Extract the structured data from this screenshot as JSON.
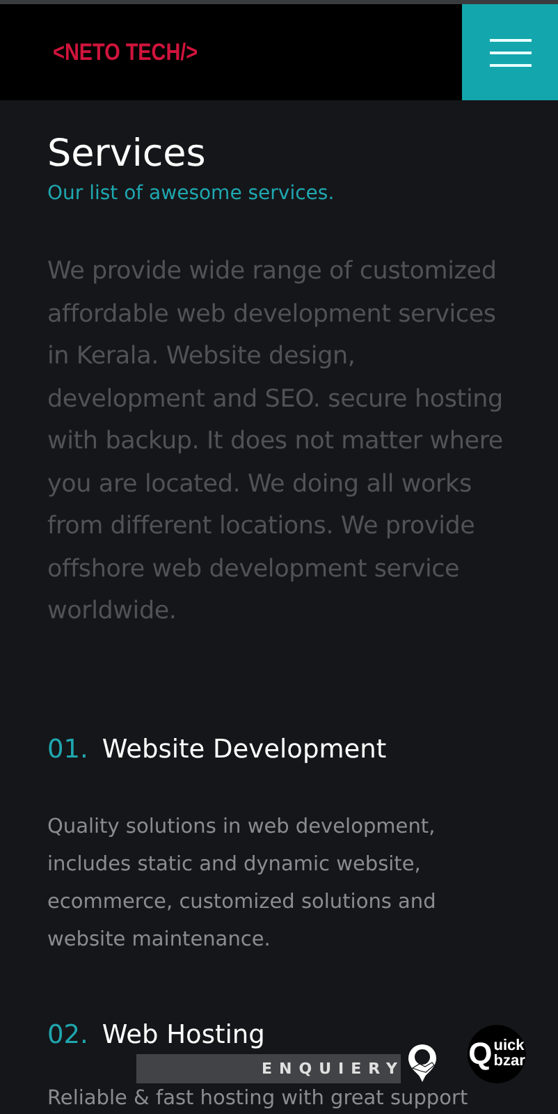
{
  "header": {
    "logo": "<NETO TECH/>"
  },
  "section": {
    "title": "Services",
    "subtitle": "Our list of awesome services.",
    "intro": "We provide wide range of customized affordable web development services in Kerala. Website design, development and SEO. secure hosting with backup. It does not matter where you are located. We doing all works from different locations. We provide offshore web development service worldwide."
  },
  "services": [
    {
      "number": "01.",
      "title": "Website Development",
      "description": "Quality solutions in web development, includes static and dynamic website, ecommerce, customized solutions and website maintenance."
    },
    {
      "number": "02.",
      "title": "Web Hosting",
      "description": "Reliable & fast hosting with great support"
    }
  ],
  "enquiry": {
    "label": "ENQUIERY"
  },
  "badge_logo": {
    "letter": "Q",
    "lines": [
      "uick",
      "bzar"
    ]
  }
}
